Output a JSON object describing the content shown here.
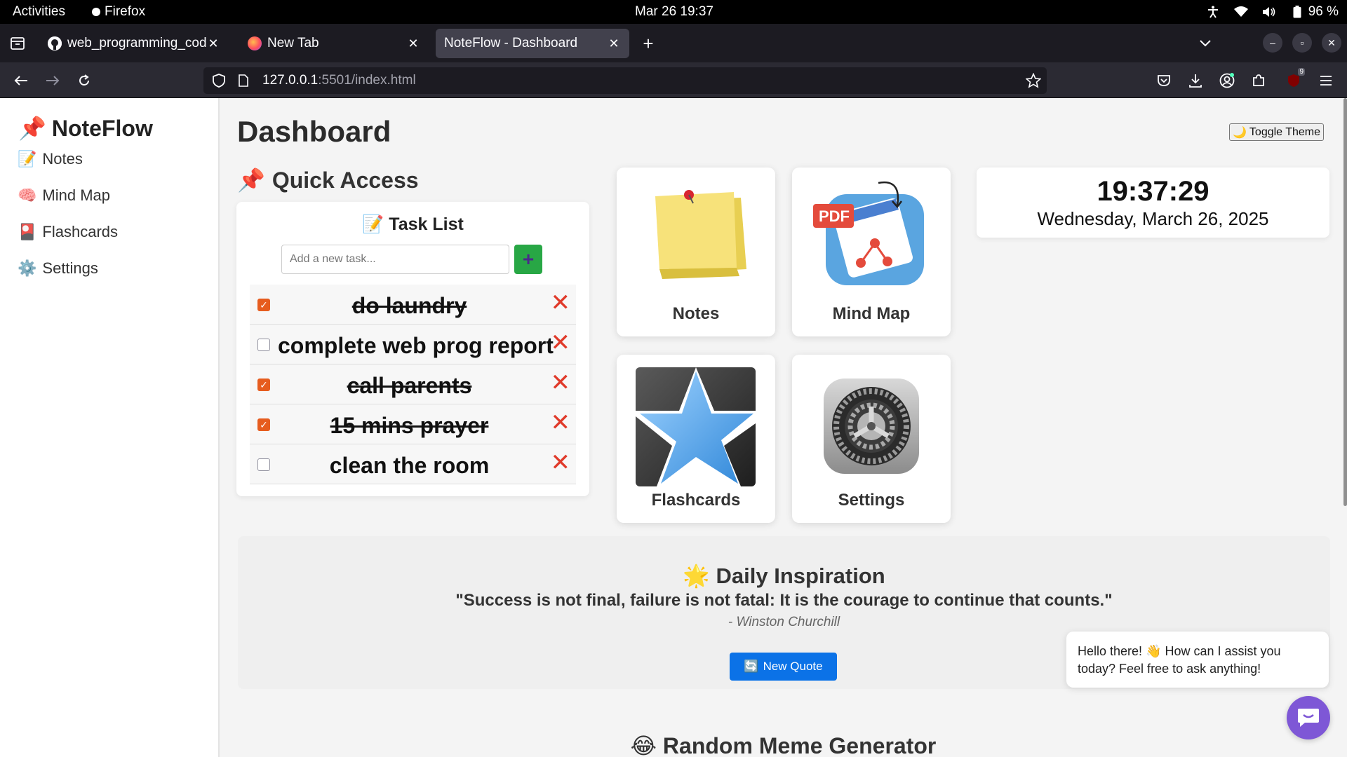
{
  "topbar": {
    "activities": "Activities",
    "app_name": "Firefox",
    "clock": "Mar 26  19:37",
    "battery": "96 %"
  },
  "browser": {
    "tabs": [
      {
        "title": "web_programming_code",
        "active": false,
        "icon": "github-icon"
      },
      {
        "title": "New Tab",
        "active": false,
        "icon": "firefox-icon"
      },
      {
        "title": "NoteFlow - Dashboard",
        "active": true,
        "icon": "none"
      }
    ],
    "url_host": "127.0.0.1",
    "url_rest": ":5501/index.html",
    "extension_badge": "9"
  },
  "sidebar": {
    "brand": "NoteFlow",
    "brand_icon": "📌",
    "items": [
      {
        "icon": "📝",
        "label": "Notes"
      },
      {
        "icon": "🧠",
        "label": "Mind Map"
      },
      {
        "icon": "🎴",
        "label": "Flashcards"
      },
      {
        "icon": "⚙️",
        "label": "Settings"
      }
    ]
  },
  "header": {
    "title": "Dashboard",
    "toggle_theme": "Toggle Theme",
    "toggle_icon": "🌙"
  },
  "quick_access": {
    "title": "Quick Access",
    "icon": "📌"
  },
  "tasks": {
    "title": "Task List",
    "title_icon": "📝",
    "placeholder": "Add a new task...",
    "add_label": "+",
    "delete_label": "✕",
    "items": [
      {
        "text": "do laundry",
        "done": true
      },
      {
        "text": "complete web prog report",
        "done": false
      },
      {
        "text": "call parents",
        "done": true
      },
      {
        "text": "15 mins prayer",
        "done": true
      },
      {
        "text": "clean the room",
        "done": false
      }
    ]
  },
  "tiles": [
    {
      "label": "Notes",
      "art": "sticky-note"
    },
    {
      "label": "Mind Map",
      "art": "mind-map"
    },
    {
      "label": "Flashcards",
      "art": "star-card"
    },
    {
      "label": "Settings",
      "art": "gear"
    }
  ],
  "clock_card": {
    "time": "19:37:29",
    "date": "Wednesday, March 26, 2025"
  },
  "inspiration": {
    "icon": "🌟",
    "title": "Daily Inspiration",
    "quote": "\"Success is not final, failure is not fatal: It is the courage to continue that counts.\"",
    "author": "- Winston Churchill",
    "button_icon": "🔄",
    "button_label": "New Quote"
  },
  "meme": {
    "icon": "😂",
    "title": "Random Meme Generator"
  },
  "chat": {
    "message": "Hello there! 👋 How can I assist you today? Feel free to ask anything!"
  },
  "colors": {
    "accent_blue": "#0b72e7",
    "add_green": "#28a745",
    "delete_red": "#e03a2a",
    "check_orange": "#e65c1e",
    "chat_purple": "#7e57d6"
  }
}
